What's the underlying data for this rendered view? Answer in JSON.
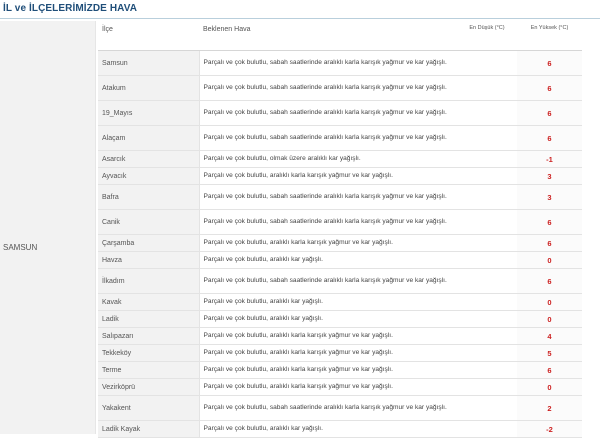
{
  "header": {
    "title": "İL ve İLÇELERİMİZDE HAVA"
  },
  "province": {
    "name": "SAMSUN"
  },
  "table": {
    "headers": {
      "district": "İlçe",
      "forecast": "Beklenen Hava",
      "min": "En Düşük (°C)",
      "max": "En Yüksek (°C)"
    },
    "rows": [
      {
        "district": "Samsun",
        "forecast": "Parçalı ve çok bulutlu, sabah saatlerinde aralıklı karla karışık yağmur ve kar yağışlı.",
        "min": "",
        "max": "6",
        "tall": true
      },
      {
        "district": "Atakum",
        "forecast": "Parçalı ve çok bulutlu, sabah saatlerinde aralıklı karla karışık yağmur ve kar yağışlı.",
        "min": "",
        "max": "6",
        "tall": true
      },
      {
        "district": "19_Mayıs",
        "forecast": "Parçalı ve çok bulutlu, sabah saatlerinde aralıklı karla karışık yağmur ve kar yağışlı.",
        "min": "",
        "max": "6",
        "tall": true
      },
      {
        "district": "Alaçam",
        "forecast": "Parçalı ve çok bulutlu, sabah saatlerinde aralıklı karla karışık yağmur ve kar yağışlı.",
        "min": "",
        "max": "6",
        "tall": true
      },
      {
        "district": "Asarcık",
        "forecast": "Parçalı ve çok bulutlu, olmak üzere aralıklı kar yağışlı.",
        "min": "",
        "max": "-1",
        "tall": false
      },
      {
        "district": "Ayvacık",
        "forecast": "Parçalı ve çok bulutlu, aralıklı karla karışık yağmur ve kar yağışlı.",
        "min": "",
        "max": "3",
        "tall": false
      },
      {
        "district": "Bafra",
        "forecast": "Parçalı ve çok bulutlu, sabah saatlerinde aralıklı karla karışık yağmur ve kar yağışlı.",
        "min": "",
        "max": "3",
        "tall": true
      },
      {
        "district": "Canik",
        "forecast": "Parçalı ve çok bulutlu, sabah saatlerinde aralıklı karla karışık yağmur ve kar yağışlı.",
        "min": "",
        "max": "6",
        "tall": true
      },
      {
        "district": "Çarşamba",
        "forecast": "Parçalı ve çok bulutlu, aralıklı karla karışık yağmur ve kar yağışlı.",
        "min": "",
        "max": "6",
        "tall": false
      },
      {
        "district": "Havza",
        "forecast": "Parçalı ve çok bulutlu, aralıklı kar yağışlı.",
        "min": "",
        "max": "0",
        "tall": false
      },
      {
        "district": "İlkadım",
        "forecast": "Parçalı ve çok bulutlu, sabah saatlerinde aralıklı karla karışık yağmur ve kar yağışlı.",
        "min": "",
        "max": "6",
        "tall": true
      },
      {
        "district": "Kavak",
        "forecast": "Parçalı ve çok bulutlu, aralıklı kar yağışlı.",
        "min": "",
        "max": "0",
        "tall": false
      },
      {
        "district": "Ladik",
        "forecast": "Parçalı ve çok bulutlu, aralıklı kar yağışlı.",
        "min": "",
        "max": "0",
        "tall": false
      },
      {
        "district": "Salıpazarı",
        "forecast": "Parçalı ve çok bulutlu, aralıklı karla karışık yağmur ve kar yağışlı.",
        "min": "",
        "max": "4",
        "tall": false
      },
      {
        "district": "Tekkeköy",
        "forecast": "Parçalı ve çok bulutlu, aralıklı karla karışık yağmur ve kar yağışlı.",
        "min": "",
        "max": "5",
        "tall": false
      },
      {
        "district": "Terme",
        "forecast": "Parçalı ve çok bulutlu, aralıklı karla karışık yağmur ve kar yağışlı.",
        "min": "",
        "max": "6",
        "tall": false
      },
      {
        "district": "Vezirköprü",
        "forecast": "Parçalı ve çok bulutlu, aralıklı karla karışık yağmur ve kar yağışlı.",
        "min": "",
        "max": "0",
        "tall": false
      },
      {
        "district": "Yakakent",
        "forecast": "Parçalı ve çok bulutlu, sabah saatlerinde aralıklı karla karışık yağmur ve kar yağışlı.",
        "min": "",
        "max": "2",
        "tall": true
      },
      {
        "district": "Ladik Kayak",
        "forecast": "Parçalı ve çok bulutlu, aralıklı kar yağışlı.",
        "min": "",
        "max": "-2",
        "tall": false
      }
    ]
  },
  "colors": {
    "title": "#1f4e79",
    "max_temp": "#cc1f1f",
    "district_bg": "#f2f2f2"
  }
}
